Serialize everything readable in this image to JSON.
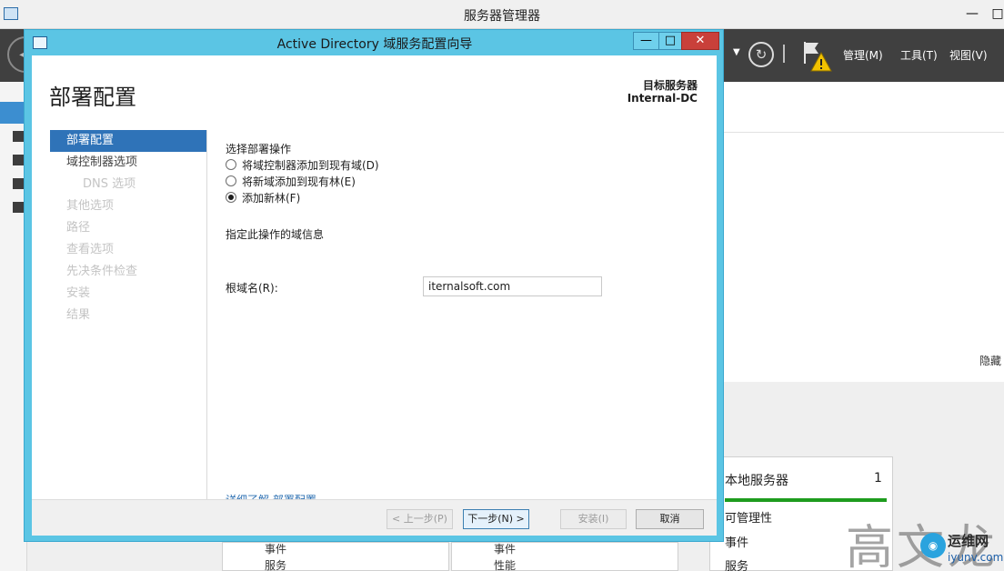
{
  "server_manager": {
    "title": "服务器管理器",
    "minimize": "—",
    "restore": "□",
    "menu": {
      "manage": "管理(M)",
      "tools": "工具(T)",
      "view": "视图(V)"
    },
    "hide_label": "隐藏",
    "local_server_tile": {
      "title": "本地服务器",
      "count": "1",
      "items": [
        "可管理性",
        "事件",
        "服务"
      ]
    },
    "bottom_tiles": [
      {
        "item1": "事件",
        "item2": "服务"
      },
      {
        "item1": "事件",
        "item2": "性能"
      }
    ]
  },
  "wizard": {
    "title": "Active Directory 域服务配置向导",
    "heading": "部署配置",
    "target_server_label": "目标服务器",
    "target_server_name": "Internal-DC",
    "nav": [
      {
        "label": "部署配置",
        "state": "active",
        "sub": false
      },
      {
        "label": "域控制器选项",
        "state": "enabled",
        "sub": false
      },
      {
        "label": "DNS 选项",
        "state": "disabled",
        "sub": true
      },
      {
        "label": "其他选项",
        "state": "disabled",
        "sub": false
      },
      {
        "label": "路径",
        "state": "disabled",
        "sub": false
      },
      {
        "label": "查看选项",
        "state": "disabled",
        "sub": false
      },
      {
        "label": "先决条件检查",
        "state": "disabled",
        "sub": false
      },
      {
        "label": "安装",
        "state": "disabled",
        "sub": false
      },
      {
        "label": "结果",
        "state": "disabled",
        "sub": false
      }
    ],
    "select_operation_label": "选择部署操作",
    "options": [
      {
        "label": "将域控制器添加到现有域(D)",
        "checked": false
      },
      {
        "label": "将新域添加到现有林(E)",
        "checked": false
      },
      {
        "label": "添加新林(F)",
        "checked": true
      }
    ],
    "domain_info_label": "指定此操作的域信息",
    "root_domain_label": "根域名(R):",
    "root_domain_value": "iternalsoft.com",
    "learn_more": "详细了解 部署配置",
    "buttons": {
      "prev": "< 上一步(P)",
      "next": "下一步(N) >",
      "install": "安装(I)",
      "cancel": "取消"
    },
    "window_controls": {
      "minimize": "—",
      "restore": "□",
      "close": "✕"
    }
  },
  "watermark": {
    "text": "高文龙",
    "site_name": "运维网",
    "site_url": "iyunv.com"
  }
}
